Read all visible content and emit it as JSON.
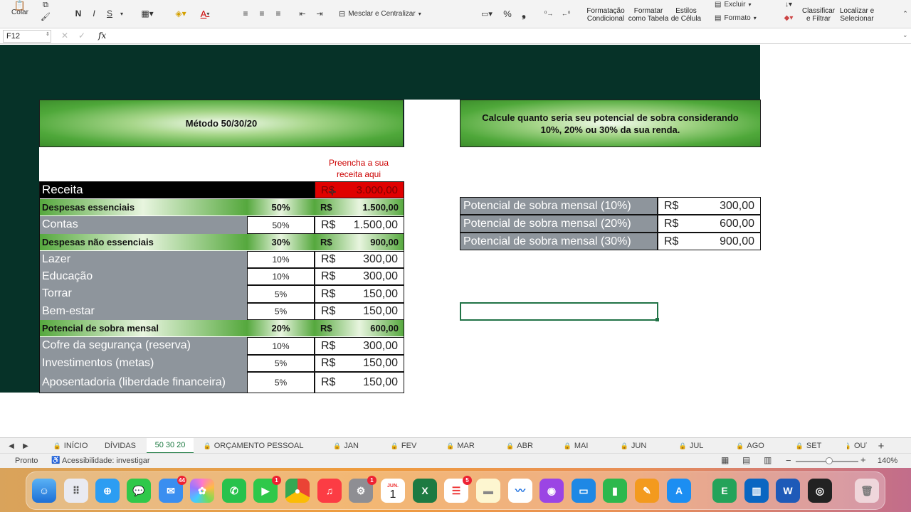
{
  "ribbon": {
    "paste_label": "Colar",
    "bold": "N",
    "italic": "I",
    "underline": "S",
    "font_color_letter": "A",
    "merge_center": "Mesclar e Centralizar",
    "percent": "%",
    "thousands": "❟",
    "cond_format": "Formatação\nCondicional",
    "format_table": "Formatar\ncomo Tabela",
    "cell_styles": "Estilos\nde Célula",
    "delete": "Excluir",
    "format": "Formato",
    "sort_filter": "Classificar\ne Filtrar",
    "find_select": "Localizar e\nSelecionar"
  },
  "formula_bar": {
    "name_box": "F12",
    "fx": "fx",
    "formula": ""
  },
  "sheet": {
    "title_left": "Método 50/30/20",
    "title_right": "Calcule quanto seria seu potencial de sobra considerando 10%, 20% ou 30% da sua renda.",
    "hint": "Preencha a sua receita aqui",
    "receita": {
      "label": "Receita",
      "currency": "R$",
      "value": "3.000,00"
    },
    "rows": [
      {
        "kind": "band",
        "label": "Despesas essenciais",
        "pct": "50%",
        "cur": "R$",
        "val": "1.500,00"
      },
      {
        "kind": "item",
        "label": "Contas",
        "pct": "50%",
        "cur": "R$",
        "val": "1.500,00"
      },
      {
        "kind": "band",
        "label": "Despesas não essenciais",
        "pct": "30%",
        "cur": "R$",
        "val": "900,00"
      },
      {
        "kind": "item",
        "label": "Lazer",
        "pct": "10%",
        "cur": "R$",
        "val": "300,00"
      },
      {
        "kind": "item",
        "label": "Educação",
        "pct": "10%",
        "cur": "R$",
        "val": "300,00"
      },
      {
        "kind": "item",
        "label": "Torrar",
        "pct": "5%",
        "cur": "R$",
        "val": "150,00"
      },
      {
        "kind": "item",
        "label": "Bem-estar",
        "pct": "5%",
        "cur": "R$",
        "val": "150,00"
      },
      {
        "kind": "band",
        "label": "Potencial de sobra mensal",
        "pct": "20%",
        "cur": "R$",
        "val": "600,00"
      },
      {
        "kind": "item",
        "label": "Cofre da segurança (reserva)",
        "pct": "10%",
        "cur": "R$",
        "val": "300,00"
      },
      {
        "kind": "item",
        "label": "Investimentos (metas)",
        "pct": "5%",
        "cur": "R$",
        "val": "150,00"
      },
      {
        "kind": "item",
        "label": "Aposentadoria (liberdade financeira)",
        "pct": "5%",
        "cur": "R$",
        "val": "150,00"
      }
    ],
    "potential": [
      {
        "label": "Potencial de sobra mensal (10%)",
        "cur": "R$",
        "val": "300,00"
      },
      {
        "label": "Potencial de sobra mensal (20%)",
        "cur": "R$",
        "val": "600,00"
      },
      {
        "label": "Potencial de sobra mensal (30%)",
        "cur": "R$",
        "val": "900,00"
      }
    ]
  },
  "tabs": [
    "INÍCIO",
    "DÍVIDAS",
    "50 30 20",
    "ORÇAMENTO PESSOAL",
    "JAN",
    "FEV",
    "MAR",
    "ABR",
    "MAI",
    "JUN",
    "JUL",
    "AGO",
    "SET",
    "OUT"
  ],
  "active_tab": "50 30 20",
  "status": {
    "ready": "Pronto",
    "accessibility": "Acessibilidade: investigar",
    "zoom": "140%"
  },
  "dock": {
    "badges": {
      "mail": "44",
      "facetime": "1",
      "reminders": "5"
    },
    "calendar_month": "JUN.",
    "calendar_day": "1"
  },
  "colors": {
    "dark_green": "#063228",
    "receita_red": "#e00000",
    "grey_label": "#8e959c",
    "hint_red": "#cc0000"
  }
}
